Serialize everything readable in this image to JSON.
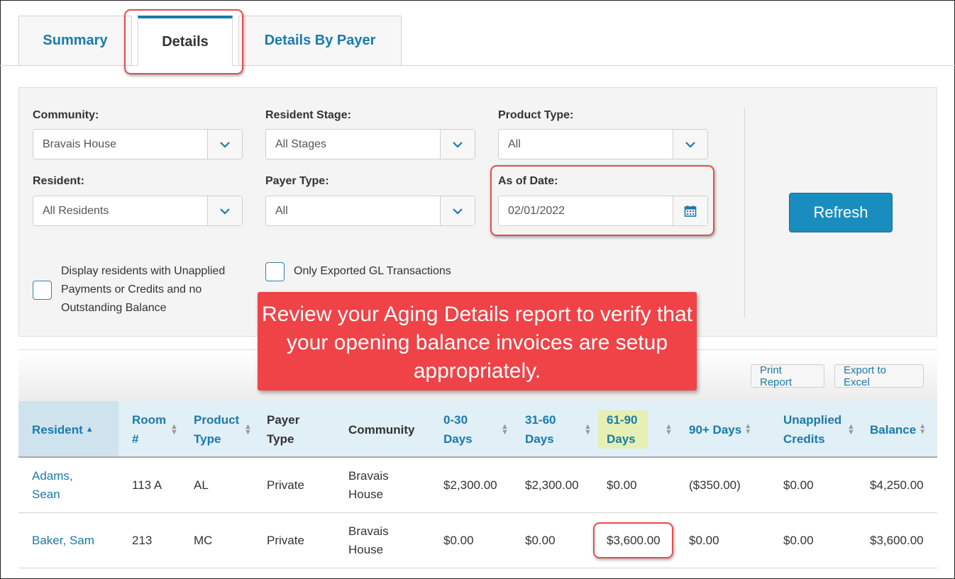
{
  "tabs": [
    "Summary",
    "Details",
    "Details By Payer"
  ],
  "filters": {
    "community_label": "Community:",
    "community_value": "Bravais House",
    "stage_label": "Resident Stage:",
    "stage_value": "All Stages",
    "product_label": "Product Type:",
    "product_value": "All",
    "resident_label": "Resident:",
    "resident_value": "All Residents",
    "payer_label": "Payer Type:",
    "payer_value": "All",
    "date_label": "As of Date:",
    "date_value": "02/01/2022",
    "checkbox1_label": "Display residents with Unapplied Payments or Credits and no Outstanding Balance",
    "checkbox2_label": "Only Exported GL Transactions",
    "refresh_label": "Refresh"
  },
  "callout": "Review your Aging Details report to verify that your opening balance invoices are setup appropriately.",
  "report": {
    "print_label": "Print Report",
    "excel_label": "Export to Excel"
  },
  "table": {
    "headers": [
      "Resident",
      "Room #",
      "Product Type",
      "Payer Type",
      "Community",
      "0-30 Days",
      "31-60 Days",
      "61-90 Days",
      "90+ Days",
      "Unapplied Credits",
      "Balance"
    ],
    "rows": [
      [
        "Adams, Sean",
        "113 A",
        "AL",
        "Private",
        "Bravais House",
        "$2,300.00",
        "$2,300.00",
        "$0.00",
        "($350.00)",
        "$0.00",
        "$4,250.00"
      ],
      [
        "Baker, Sam",
        "213",
        "MC",
        "Private",
        "Bravais House",
        "$0.00",
        "$0.00",
        "$3,600.00",
        "$0.00",
        "$0.00",
        "$3,600.00"
      ]
    ]
  },
  "colors": {
    "accent": "#1a7aab",
    "callout": "#ef4348",
    "highlight_border": "#e74c4c",
    "highlight_col": "#e5f0b2"
  },
  "icons": [
    "chevron-down-icon",
    "calendar-icon",
    "sort-icon",
    "sort-asc-icon"
  ]
}
